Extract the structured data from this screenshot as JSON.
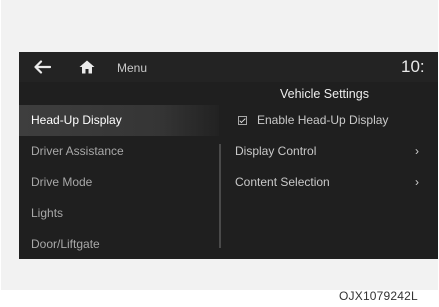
{
  "header": {
    "back_icon": "back-arrow-icon",
    "home_icon": "home-icon",
    "menu_label": "Menu",
    "clock": "10:"
  },
  "panel": {
    "title": "Vehicle Settings"
  },
  "sidebar": {
    "items": [
      {
        "label": "Head-Up Display",
        "active": true
      },
      {
        "label": "Driver Assistance",
        "active": false
      },
      {
        "label": "Drive Mode",
        "active": false
      },
      {
        "label": "Lights",
        "active": false
      },
      {
        "label": "Door/Liftgate",
        "active": false
      }
    ]
  },
  "content": {
    "enable_hud": {
      "label": "Enable Head-Up Display",
      "checked": true
    },
    "display_control": {
      "label": "Display Control",
      "chevron": "›"
    },
    "content_selection": {
      "label": "Content Selection",
      "chevron": "›"
    }
  },
  "footer": {
    "code": "OJX1079242L"
  },
  "colors": {
    "screen_bg": "#1f1f1f",
    "active_bg": "#3e3e3e",
    "text": "#a8a8a8"
  }
}
